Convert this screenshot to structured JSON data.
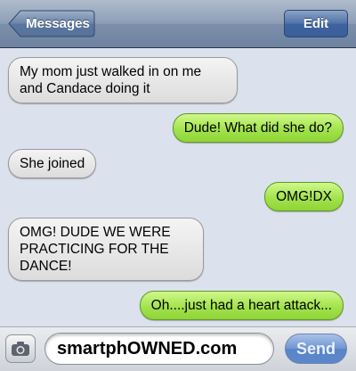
{
  "navbar": {
    "back_label": "Messages",
    "edit_label": "Edit"
  },
  "messages": [
    {
      "direction": "received",
      "text": "My mom just walked in on me and Candace doing it"
    },
    {
      "direction": "sent",
      "text": "Dude! What did she do?"
    },
    {
      "direction": "received",
      "text": "She joined"
    },
    {
      "direction": "sent",
      "text": "OMG!DX"
    },
    {
      "direction": "received",
      "text": "OMG! DUDE WE WERE PRACTICING FOR THE DANCE!"
    },
    {
      "direction": "sent",
      "text": "Oh....just had a heart attack..."
    }
  ],
  "composer": {
    "input_value": "smartphOWNED.com",
    "send_label": "Send",
    "camera_icon": "camera-icon"
  },
  "colors": {
    "sent_bubble": "#a3e34d",
    "received_bubble": "#e8e8e8",
    "background": "#dbe2ed",
    "send_button": "#6f94d2"
  }
}
